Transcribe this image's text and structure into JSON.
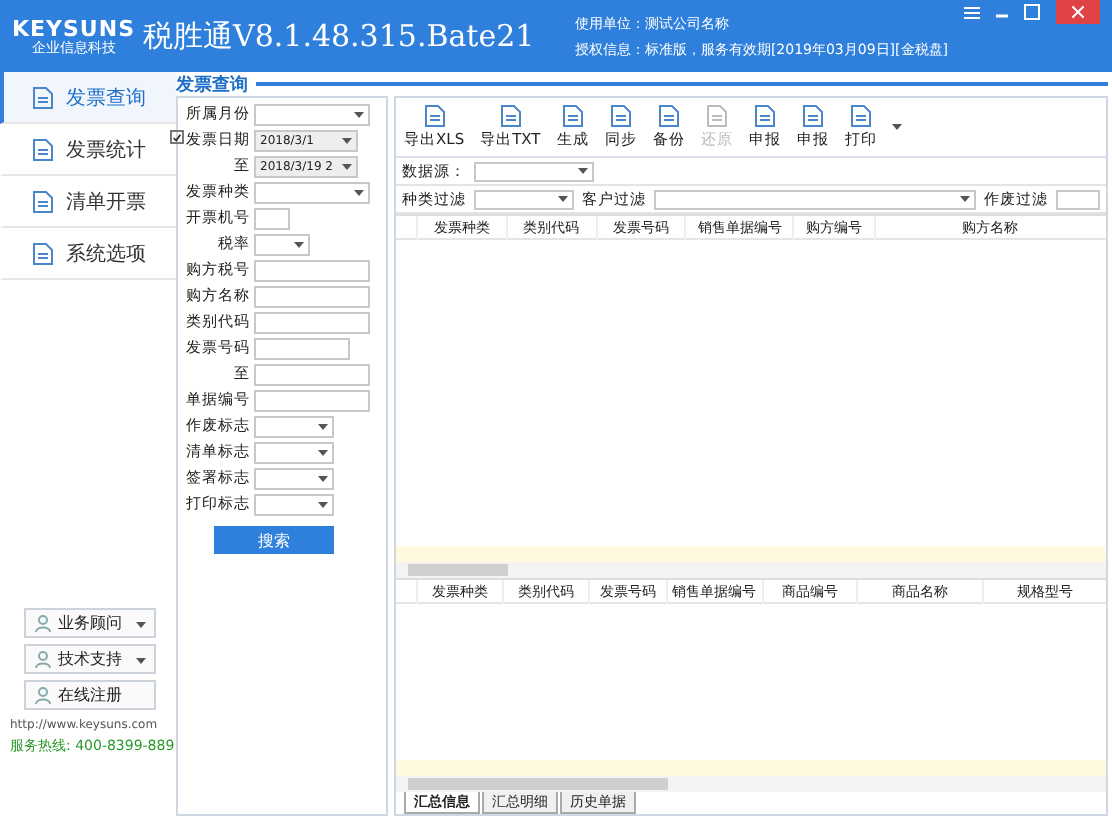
{
  "window": {
    "logo_top": "KEYSUNS",
    "logo_bottom": "企业信息科技",
    "title": "税胜通V8.1.48.315.Bate21",
    "user_unit": "使用单位：测试公司名称",
    "license": "授权信息：标准版，服务有效期[2019年03月09日][金税盘]"
  },
  "sidebar": {
    "items": [
      {
        "label": "发票查询",
        "selected": true
      },
      {
        "label": "发票统计",
        "selected": false
      },
      {
        "label": "清单开票",
        "selected": false
      },
      {
        "label": "系统选项",
        "selected": false
      }
    ],
    "support_buttons": [
      {
        "label": "业务顾问",
        "kind": "dropdown"
      },
      {
        "label": "技术支持",
        "kind": "dropdown"
      },
      {
        "label": "在线注册",
        "kind": "plain"
      }
    ],
    "website": "http://www.keysuns.com",
    "hotline": "服务热线: 400-8399-889"
  },
  "section_title": "发票查询",
  "form": {
    "fields": [
      {
        "label": "所属月份",
        "kind": "select"
      },
      {
        "label": "发票日期",
        "kind": "date",
        "checked": true,
        "value": "2018/3/1"
      },
      {
        "label": "至",
        "kind": "date",
        "value": "2018/3/19 2"
      },
      {
        "label": "发票种类",
        "kind": "select"
      },
      {
        "label": "开票机号",
        "kind": "short"
      },
      {
        "label": "税率",
        "kind": "small-select"
      },
      {
        "label": "购方税号",
        "kind": "text"
      },
      {
        "label": "购方名称",
        "kind": "text"
      },
      {
        "label": "类别代码",
        "kind": "text"
      },
      {
        "label": "发票号码",
        "kind": "text"
      },
      {
        "label": "至",
        "kind": "text"
      },
      {
        "label": "单据编号",
        "kind": "text"
      },
      {
        "label": "作废标志",
        "kind": "select"
      },
      {
        "label": "清单标志",
        "kind": "select"
      },
      {
        "label": "签署标志",
        "kind": "select"
      },
      {
        "label": "打印标志",
        "kind": "select"
      }
    ],
    "search_button": "搜索"
  },
  "toolbar": [
    {
      "label": "导出XLS",
      "disabled": false
    },
    {
      "label": "导出TXT",
      "disabled": false
    },
    {
      "label": "生成",
      "disabled": false
    },
    {
      "label": "同步",
      "disabled": false
    },
    {
      "label": "备份",
      "disabled": false
    },
    {
      "label": "还原",
      "disabled": true
    },
    {
      "label": "申报",
      "disabled": false
    },
    {
      "label": "申报",
      "disabled": false
    },
    {
      "label": "打印",
      "disabled": false
    }
  ],
  "filters": {
    "data_source": "数据源：",
    "type_filter": "种类过滤",
    "customer_filter": "客户过滤",
    "void_filter": "作废过滤"
  },
  "upper_table": {
    "columns": [
      "发票种类",
      "类别代码",
      "发票号码",
      "销售单据编号",
      "购方编号",
      "购方名称"
    ]
  },
  "lower_table": {
    "columns": [
      "发票种类",
      "类别代码",
      "发票号码",
      "销售单据编号",
      "商品编号",
      "商品名称",
      "规格型号"
    ]
  },
  "bottom_tabs": [
    {
      "label": "汇总信息",
      "selected": true
    },
    {
      "label": "汇总明细",
      "selected": false
    },
    {
      "label": "历史单据",
      "selected": false
    }
  ]
}
